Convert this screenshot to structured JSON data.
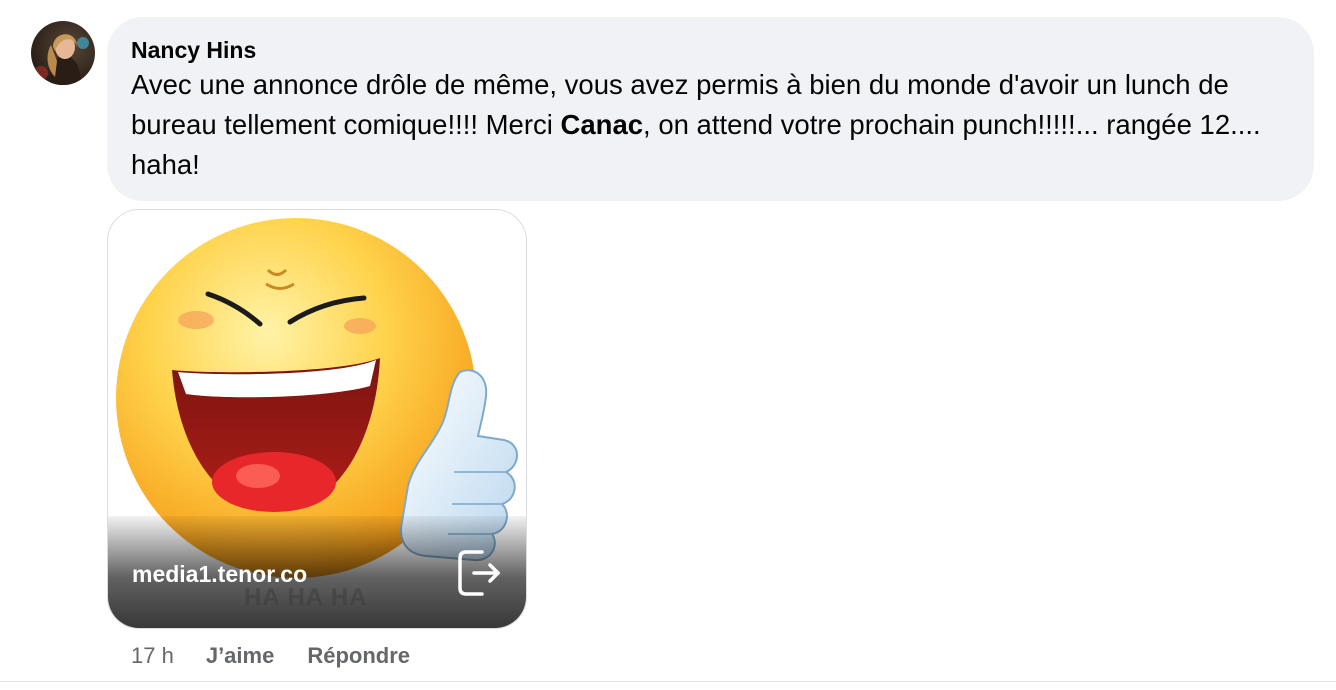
{
  "comment": {
    "author": "Nancy Hins",
    "text_before": "Avec une annonce drôle de même, vous avez permis à bien du monde d'avoir un lunch de bureau tellement comique!!!! Merci ",
    "mention": "Canac",
    "text_after": ", on attend votre prochain punch!!!!!... rangée 12.... haha!",
    "avatar_icon": "profile-photo"
  },
  "gif": {
    "domain": "media1.tenor.co",
    "caption": "HA HA HA",
    "share_icon": "open-external-icon"
  },
  "actions": {
    "time": "17 h",
    "like": "J’aime",
    "reply": "Répondre"
  },
  "colors": {
    "bubble": "#f0f2f5",
    "meta_text": "#65676b",
    "text": "#050505"
  }
}
